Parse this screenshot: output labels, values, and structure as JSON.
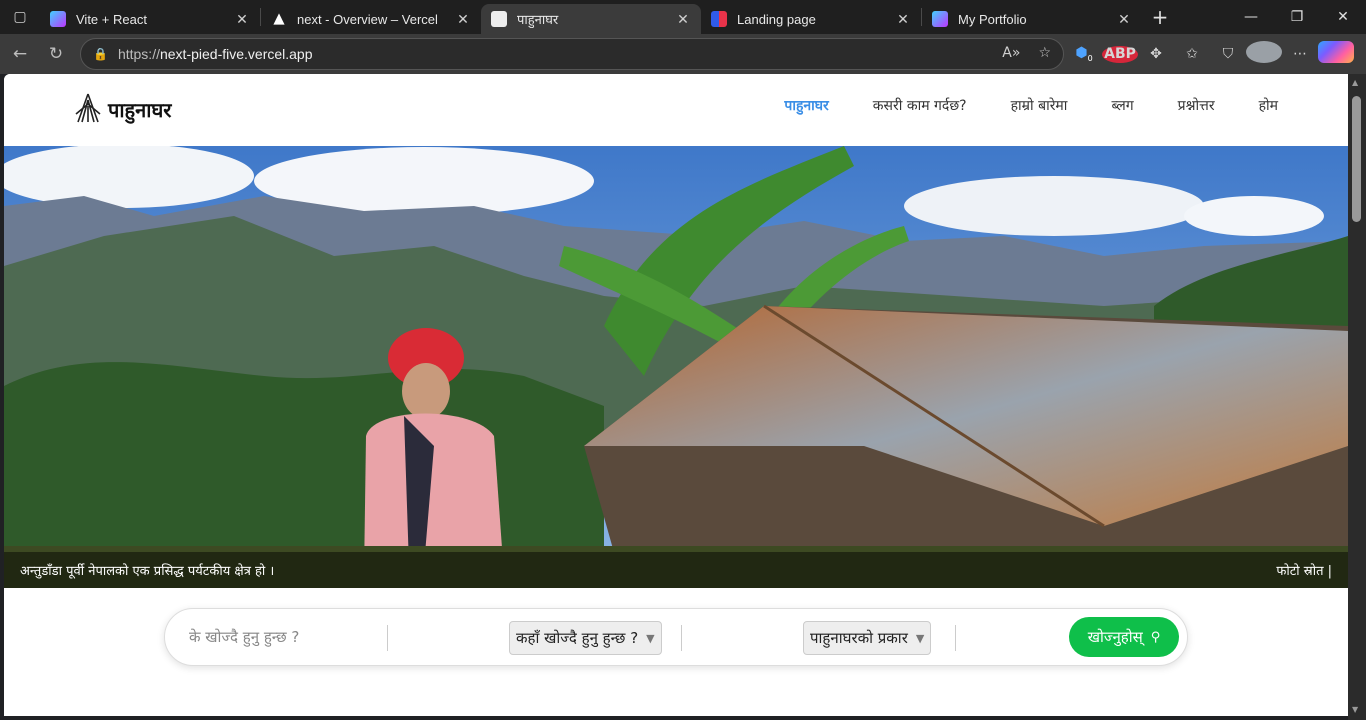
{
  "browser": {
    "tabs": [
      {
        "title": "Vite + React",
        "favicon_color": "#a259ff",
        "active": false
      },
      {
        "title": "next - Overview – Vercel",
        "favicon_color": "#000000",
        "active": false
      },
      {
        "title": "पाहुनाघर",
        "favicon_color": "#ffffff",
        "active": true
      },
      {
        "title": "Landing page",
        "favicon_color": "#2f5bea",
        "active": false
      },
      {
        "title": "My Portfolio",
        "favicon_color": "#a259ff",
        "active": false
      }
    ],
    "url_scheme": "https://",
    "url_host": "next-pied-five.vercel.app",
    "extension_badge": "0",
    "abp_label": "ABP"
  },
  "site": {
    "logo_text": "पाहुनाघर",
    "nav": [
      {
        "label": "पाहुनाघर",
        "active": true
      },
      {
        "label": "कसरी काम गर्दछ?",
        "active": false
      },
      {
        "label": "हाम्रो बारेमा",
        "active": false
      },
      {
        "label": "ब्लग",
        "active": false
      },
      {
        "label": "प्रश्नोत्तर",
        "active": false
      },
      {
        "label": "होम",
        "active": false
      }
    ],
    "hero_caption": "अन्तुडाँडा पूर्वी नेपालको एक प्रसिद्ध पर्यटकीय क्षेत्र हो ।",
    "photo_credit": "फोटो स्रोत |",
    "search": {
      "placeholder": "के खोज्दै हुनु हुन्छ ?",
      "location_select": "कहाँ खोज्दै हुनु हुन्छ ?",
      "type_select": "पाहुनाघरको प्रकार",
      "button_label": "खोज्नुहोस्"
    }
  },
  "colors": {
    "nav_active": "#3a8ee6",
    "search_button": "#0fbf4a"
  }
}
